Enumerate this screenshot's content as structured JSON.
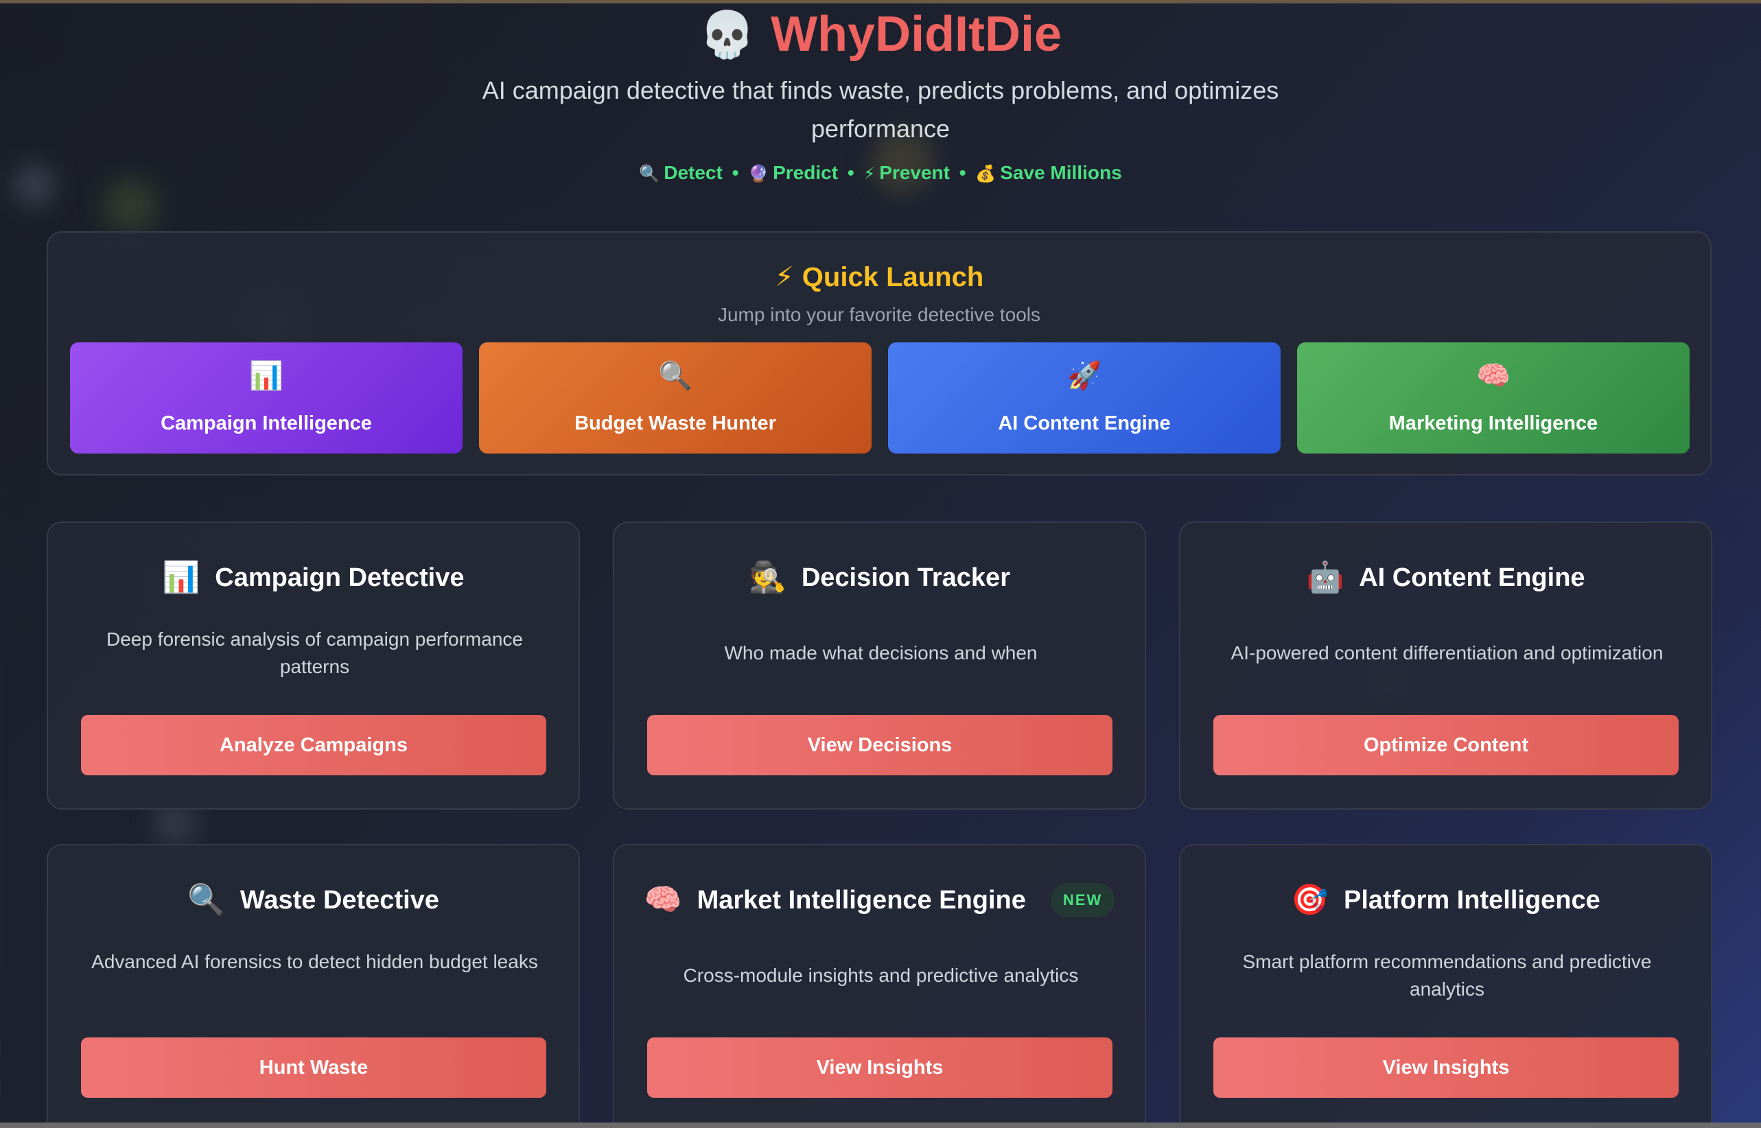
{
  "header": {
    "logo_icon": "💀",
    "title": "WhyDidItDie",
    "subtitle": "AI campaign detective that finds waste, predicts problems, and optimizes performance",
    "tagline": [
      {
        "icon": "🔍",
        "label": "Detect"
      },
      {
        "icon": "🔮",
        "label": "Predict"
      },
      {
        "icon": "⚡",
        "label": "Prevent"
      },
      {
        "icon": "💰",
        "label": "Save Millions"
      }
    ],
    "tagline_separator": "•"
  },
  "quick_launch": {
    "icon": "⚡",
    "title": "Quick Launch",
    "subtitle": "Jump into your favorite detective tools",
    "buttons": [
      {
        "icon": "📊",
        "label": "Campaign Intelligence",
        "color": "#8b3fe8"
      },
      {
        "icon": "🔍",
        "label": "Budget Waste Hunter",
        "color": "#db6a2b"
      },
      {
        "icon": "🚀",
        "label": "AI Content Engine",
        "color": "#3b6ae8"
      },
      {
        "icon": "🧠",
        "label": "Marketing Intelligence",
        "color": "#44a050"
      }
    ]
  },
  "cards": [
    {
      "icon": "📊",
      "title": "Campaign Detective",
      "description": "Deep forensic analysis of campaign performance patterns",
      "button": "Analyze Campaigns"
    },
    {
      "icon": "🕵️",
      "title": "Decision Tracker",
      "description": "Who made what decisions and when",
      "button": "View Decisions"
    },
    {
      "icon": "🤖",
      "title": "AI Content Engine",
      "description": "AI-powered content differentiation and optimization",
      "button": "Optimize Content"
    },
    {
      "icon": "🔍",
      "title": "Waste Detective",
      "description": "Advanced AI forensics to detect hidden budget leaks",
      "button": "Hunt Waste"
    },
    {
      "icon": "🧠",
      "title": "Market Intelligence Engine",
      "badge": "NEW",
      "description": "Cross-module insights and predictive analytics",
      "button": "View Insights"
    },
    {
      "icon": "🎯",
      "title": "Platform Intelligence",
      "description": "Smart platform recommendations and predictive analytics",
      "button": "View Insights"
    }
  ],
  "colors": {
    "brand_red": "#ef6461",
    "accent_green": "#4ade80",
    "accent_gold": "#fbbf24",
    "card_button": "#e86a66"
  }
}
